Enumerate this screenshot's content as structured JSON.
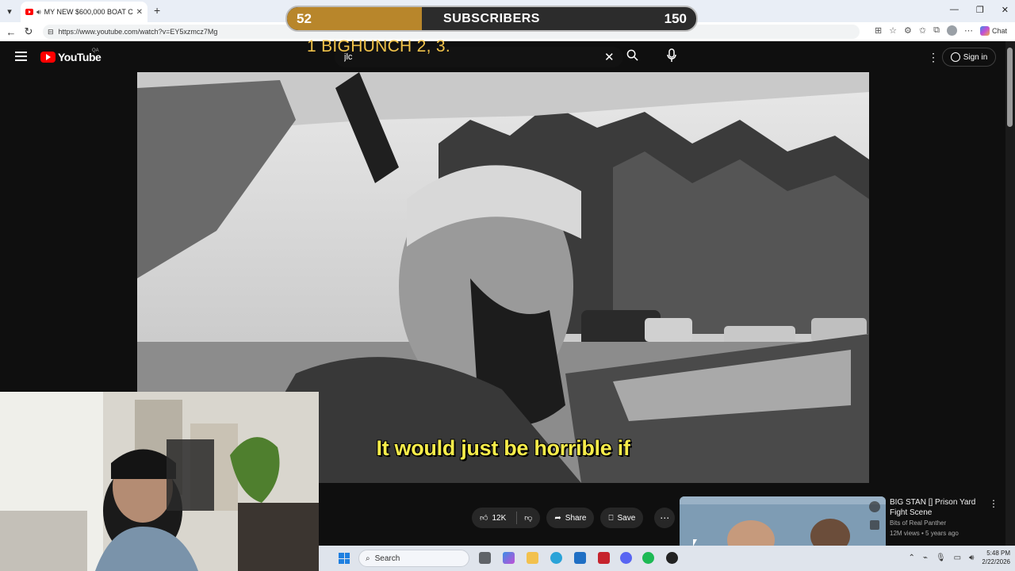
{
  "browser": {
    "tab_title": "MY NEW $600,000 BOAT CAU",
    "url": "https://www.youtube.com/watch?v=EY5xzmcz7Mg",
    "chat_label": "Chat"
  },
  "overlay": {
    "sub_current": "52",
    "sub_label": "SUBSCRIBERS",
    "sub_goal": "150",
    "progress_fraction": 0.33,
    "ticker_text": "1 BIGHUNCH  2, 3."
  },
  "youtube": {
    "logo_text": "YouTube",
    "country_code": "QA",
    "search_value": "jlc",
    "signin_label": "Sign in"
  },
  "video": {
    "caption": "It would just be horrible if"
  },
  "actions": {
    "like_count": "12K",
    "share_label": "Share",
    "save_label": "Save"
  },
  "recommendation": {
    "title": "BIG STAN [] Prison Yard Fight Scene",
    "channel": "Bits of Real Panther",
    "meta": "12M views • 5 years ago"
  },
  "taskbar": {
    "search_placeholder": "Search",
    "time": "5:48 PM",
    "date": "2/22/2026"
  },
  "colors": {
    "yt_red": "#ff0000",
    "caption_yellow": "#f6ec4a",
    "progress_gold": "#b8862b",
    "ticker_gold": "#f0c24a"
  }
}
